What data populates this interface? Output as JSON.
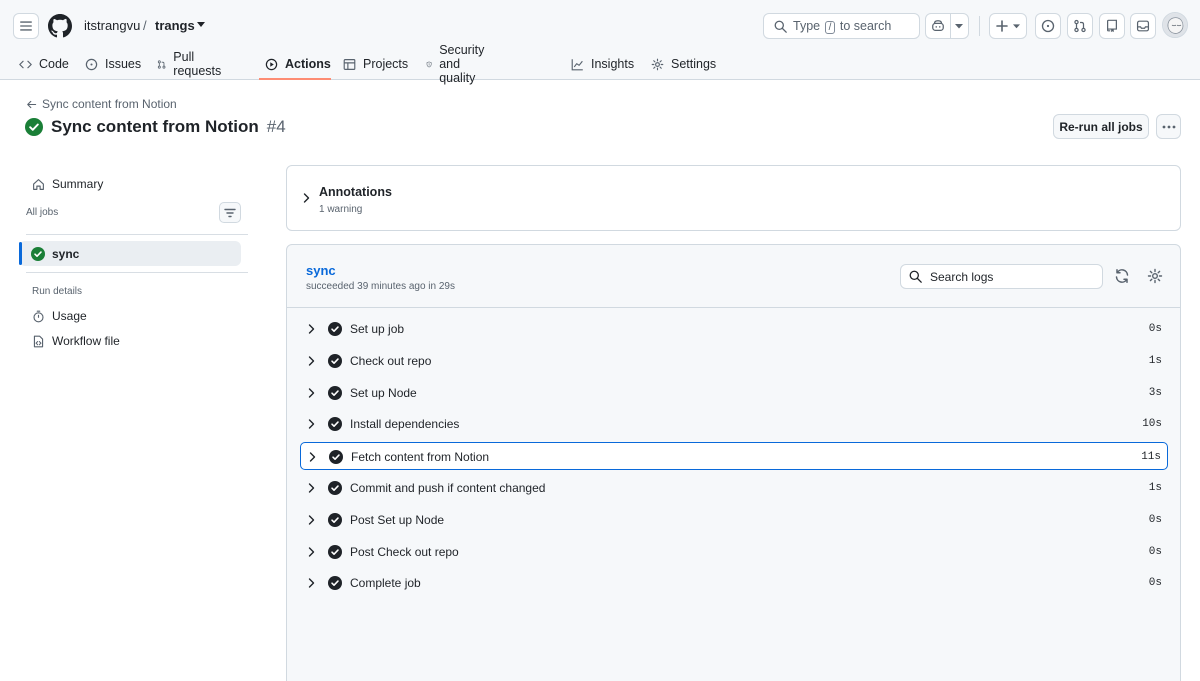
{
  "header": {
    "owner": "itstrangvu",
    "separator": "/",
    "repo": "trangs",
    "search": {
      "prefix": "Type",
      "key": "/",
      "suffix": "to search"
    }
  },
  "tabs": [
    {
      "label": "Code",
      "icon": "code-icon"
    },
    {
      "label": "Issues",
      "icon": "issue-icon"
    },
    {
      "label": "Pull requests",
      "icon": "pull-request-icon"
    },
    {
      "label": "Actions",
      "icon": "play-icon",
      "active": true
    },
    {
      "label": "Projects",
      "icon": "table-icon"
    },
    {
      "label": "Security and quality",
      "icon": "shield-icon"
    },
    {
      "label": "Insights",
      "icon": "graph-icon"
    },
    {
      "label": "Settings",
      "icon": "gear-icon"
    }
  ],
  "run": {
    "back_label": "Sync content from Notion",
    "title": "Sync content from Notion",
    "number": "#4",
    "rerun_label": "Re-run all jobs"
  },
  "sidebar": {
    "summary": "Summary",
    "all_jobs": "All jobs",
    "job": "sync",
    "run_details": "Run details",
    "usage": "Usage",
    "workflow_file": "Workflow file"
  },
  "annotations": {
    "title": "Annotations",
    "subtitle": "1 warning"
  },
  "job": {
    "name": "sync",
    "meta": "succeeded 39 minutes ago in 29s",
    "search_placeholder": "Search logs",
    "steps": [
      {
        "label": "Set up job",
        "duration": "0s"
      },
      {
        "label": "Check out repo",
        "duration": "1s"
      },
      {
        "label": "Set up Node",
        "duration": "3s"
      },
      {
        "label": "Install dependencies",
        "duration": "10s"
      },
      {
        "label": "Fetch content from Notion",
        "duration": "11s",
        "focused": true
      },
      {
        "label": "Commit and push if content changed",
        "duration": "1s"
      },
      {
        "label": "Post Set up Node",
        "duration": "0s"
      },
      {
        "label": "Post Check out repo",
        "duration": "0s"
      },
      {
        "label": "Complete job",
        "duration": "0s"
      }
    ]
  },
  "colors": {
    "success": "#1a7f37",
    "link": "#0969da",
    "tab_underline": "#fd8c73",
    "step_check": "#1f2328"
  }
}
